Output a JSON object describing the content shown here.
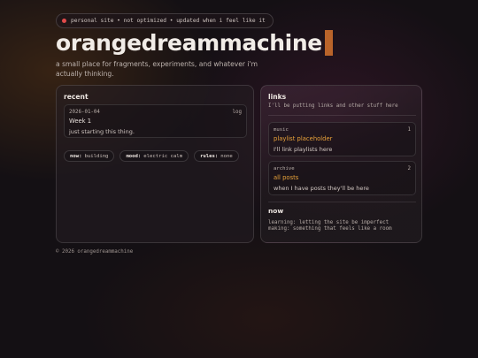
{
  "header": {
    "status_pill": "personal site • not optimized • updated when i feel like it",
    "title": "orangedreammachine",
    "tagline": "a small place for fragments, experiments, and whatever i'm actually thinking."
  },
  "recent": {
    "heading": "recent",
    "entry": {
      "date": "2026-01-04",
      "tag": "log",
      "title": "Week 1",
      "body": "just starting this thing."
    },
    "chips": [
      {
        "key": "now:",
        "value": "building"
      },
      {
        "key": "mood:",
        "value": "electric calm"
      },
      {
        "key": "rules:",
        "value": "none"
      }
    ]
  },
  "links": {
    "heading": "links",
    "subtitle": "I'll be putting links and other stuff here",
    "cards": [
      {
        "category": "music",
        "count": "1",
        "title": "playlist placeholder",
        "description": "I'll link playlists here"
      },
      {
        "category": "archive",
        "count": "2",
        "title": "all posts",
        "description": "when I have posts they'll be here"
      }
    ]
  },
  "now": {
    "heading": "now",
    "lines": [
      "learning: letting the site be imperfect",
      "making: something that feels like a room"
    ]
  },
  "footer": "© 2026 orangedreammachine",
  "colors": {
    "accent": "#e9a23a",
    "cursor": "#b9642a",
    "status_dot": "#e04a4a",
    "background": "#141014"
  }
}
